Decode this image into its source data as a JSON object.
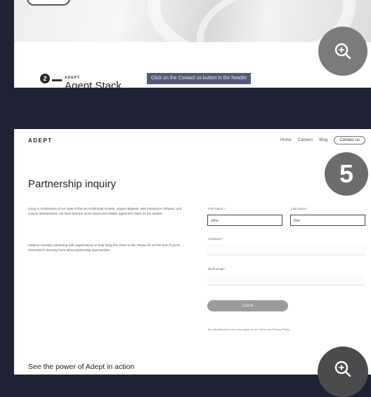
{
  "top_card": {
    "brand_small": "ADEPT",
    "product_name": "Agent Stack",
    "step_number": "2",
    "instruction": "Click on the Contact us button in the header"
  },
  "header": {
    "brand": "ADEPT",
    "nav": [
      "Home",
      "Careers",
      "Blog"
    ],
    "contact_label": "Contact us"
  },
  "step_badge": "5",
  "page": {
    "title": "Partnership inquiry",
    "paragraph1": "Using a combination of our state-of-the-art multimodal models, unique datasets, web interaction software, and custom infrastructure, we have built the most robust and reliable agent tech stack on the market.",
    "paragraph2": "Adept is currently partnering with organizations to help bring this vision to life. Please fill out the form if you're interested in learning more about partnership opportunities."
  },
  "form": {
    "first_name_label": "First name *",
    "first_name_value": "John",
    "last_name_label": "Last name *",
    "last_name_value": "Doe",
    "company_label": "Company *",
    "company_value": "",
    "workemail_label": "Work email *",
    "workemail_value": "",
    "submit_label": "Submit",
    "terms_text": "By submitting this form you agree to our Terms and Privacy Policy"
  },
  "footer_section_title": "See the power of Adept in action",
  "icons": {
    "zoom": "zoom-in-icon"
  }
}
